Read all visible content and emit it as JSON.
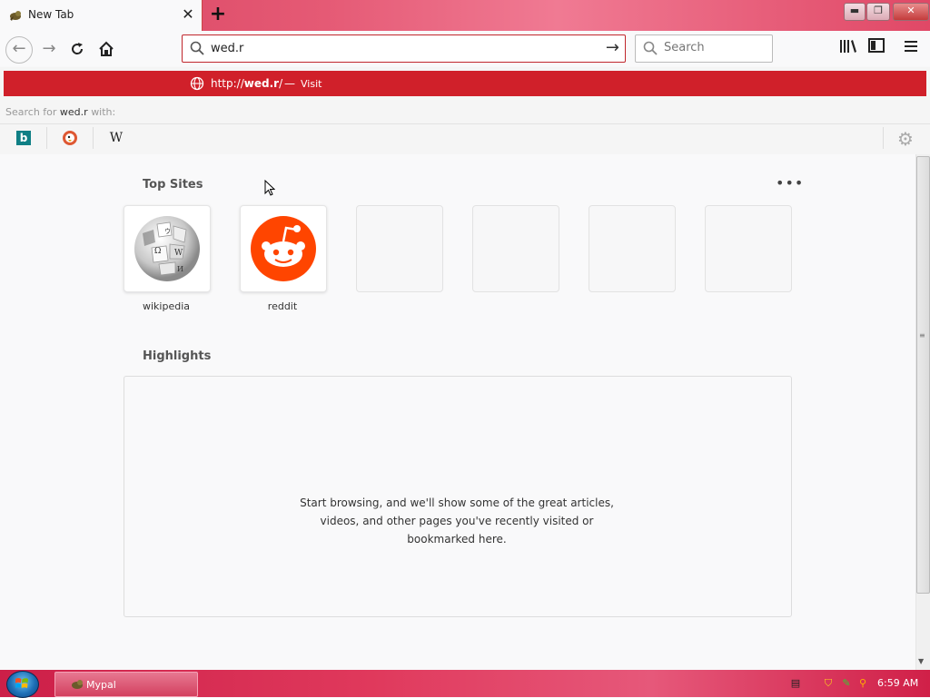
{
  "browser": {
    "tab": {
      "title": "New Tab",
      "close_label": "✕"
    },
    "new_tab_label": "+",
    "window_buttons": {
      "minimize": "▬",
      "maximize": "❐",
      "close": "✕"
    }
  },
  "navbar": {
    "url_value": "wed.r",
    "search_placeholder": "Search"
  },
  "autocomplete": {
    "url_prefix": "http://",
    "url_bold": "wed.r",
    "url_suffix": "/",
    "separator": "—",
    "action": "Visit",
    "search_for_prefix": "Search for",
    "search_for_query": "wed.r",
    "search_for_suffix": "with:",
    "engines": [
      {
        "name": "bing",
        "icon": "bing-icon",
        "glyph": "b"
      },
      {
        "name": "duckduckgo",
        "icon": "duckduckgo-icon",
        "glyph": ""
      },
      {
        "name": "wikipedia",
        "icon": "wikipedia-icon",
        "glyph": "W"
      }
    ]
  },
  "content": {
    "top_sites_title": "Top Sites",
    "more_label": "•••",
    "top_sites": [
      {
        "label": "wikipedia",
        "icon": "wikipedia-globe-icon"
      },
      {
        "label": "reddit",
        "icon": "reddit-icon"
      },
      {
        "label": ""
      },
      {
        "label": ""
      },
      {
        "label": ""
      },
      {
        "label": ""
      }
    ],
    "highlights_title": "Highlights",
    "highlights_message": [
      "Start browsing, and we'll show some of the great articles,",
      "videos, and other pages you've recently visited or",
      "bookmarked here."
    ]
  },
  "taskbar": {
    "task_label": "Mypal",
    "clock": "6:59 AM"
  },
  "colors": {
    "accent_red": "#d0202a",
    "reddit_orange": "#ff4500",
    "taskbar_pink": "#e0395c"
  }
}
